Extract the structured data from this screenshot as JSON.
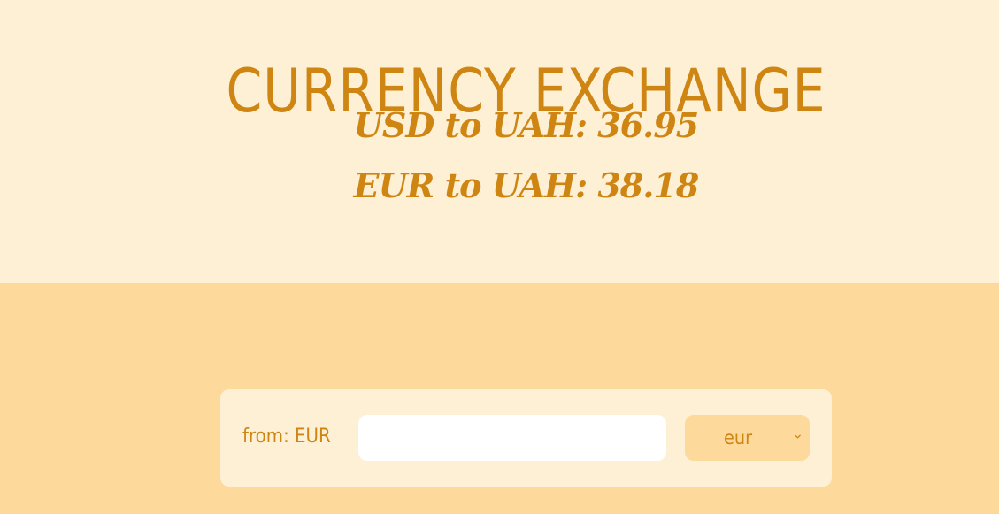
{
  "header": {
    "title": "CURRENCY EXCHANGE",
    "rates": [
      {
        "label": "USD to UAH: 36.95"
      },
      {
        "label": "EUR to UAH: 38.18"
      }
    ]
  },
  "converter": {
    "from_label": "from: EUR",
    "amount": {
      "value": "",
      "placeholder": ""
    },
    "currency_select": {
      "selected": "eur",
      "icon": "chevron-down-icon"
    }
  },
  "colors": {
    "accent": "#cf8512",
    "header_background": "#fdf0d5",
    "page_background": "#fdd99b",
    "panel_background": "#fdf0d5",
    "input_background": "#ffffff"
  }
}
